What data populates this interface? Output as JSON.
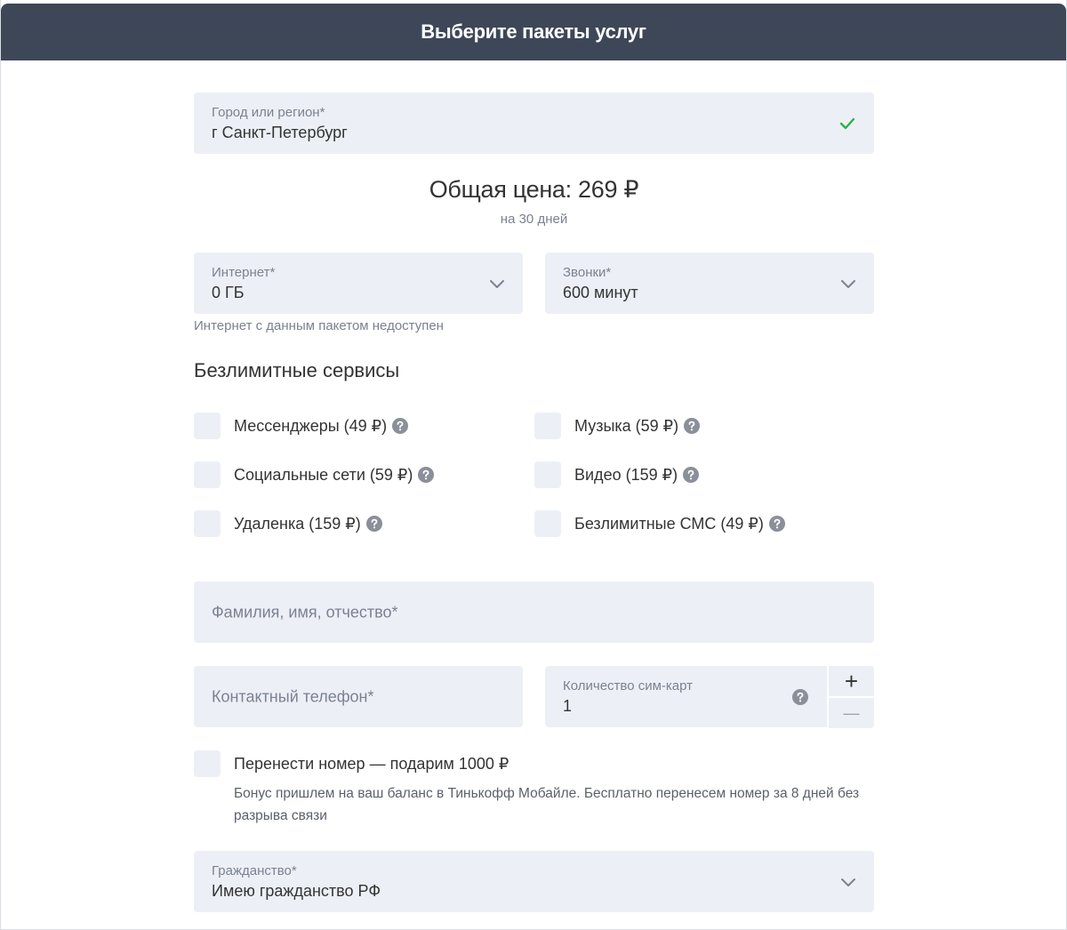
{
  "header": {
    "title": "Выберите пакеты услуг"
  },
  "city": {
    "label": "Город или регион*",
    "value": "г Санкт-Петербург"
  },
  "price": {
    "total": "Общая цена: 269 ₽",
    "period": "на 30 дней"
  },
  "internet": {
    "label": "Интернет*",
    "value": "0 ГБ",
    "hint": "Интернет с данным пакетом недоступен"
  },
  "calls": {
    "label": "Звонки*",
    "value": "600 минут"
  },
  "services": {
    "title": "Безлимитные сервисы",
    "items": [
      {
        "label": "Мессенджеры (49 ₽)",
        "checked": false
      },
      {
        "label": "Музыка (59 ₽)",
        "checked": false
      },
      {
        "label": "Социальные сети (59 ₽)",
        "checked": false
      },
      {
        "label": "Видео (159 ₽)",
        "checked": false
      },
      {
        "label": "Удаленка (159 ₽)",
        "checked": false
      },
      {
        "label": "Безлимитные СМС (49 ₽)",
        "checked": false
      }
    ]
  },
  "fullname": {
    "placeholder": "Фамилия, имя, отчество*"
  },
  "phone": {
    "placeholder": "Контактный телефон*"
  },
  "sims": {
    "label": "Количество сим-карт",
    "value": "1",
    "plus": "+",
    "minus": "—"
  },
  "transfer": {
    "label": "Перенести номер — подарим 1000 ₽",
    "checked": false,
    "bonus": "Бонус пришлем на ваш баланс в Тинькофф Мобайле. Бесплатно перенесем номер за 8 дней без разрыва связи"
  },
  "citizenship": {
    "label": "Гражданство*",
    "value": "Имею гражданство РФ"
  },
  "colors": {
    "header": "#3d4757",
    "field": "#ecf0f6",
    "check": "#2bb24c",
    "muted": "#7b8190"
  },
  "icons": {
    "check": "check-icon",
    "chevron": "chevron-down-icon",
    "help": "question-circle-icon"
  }
}
